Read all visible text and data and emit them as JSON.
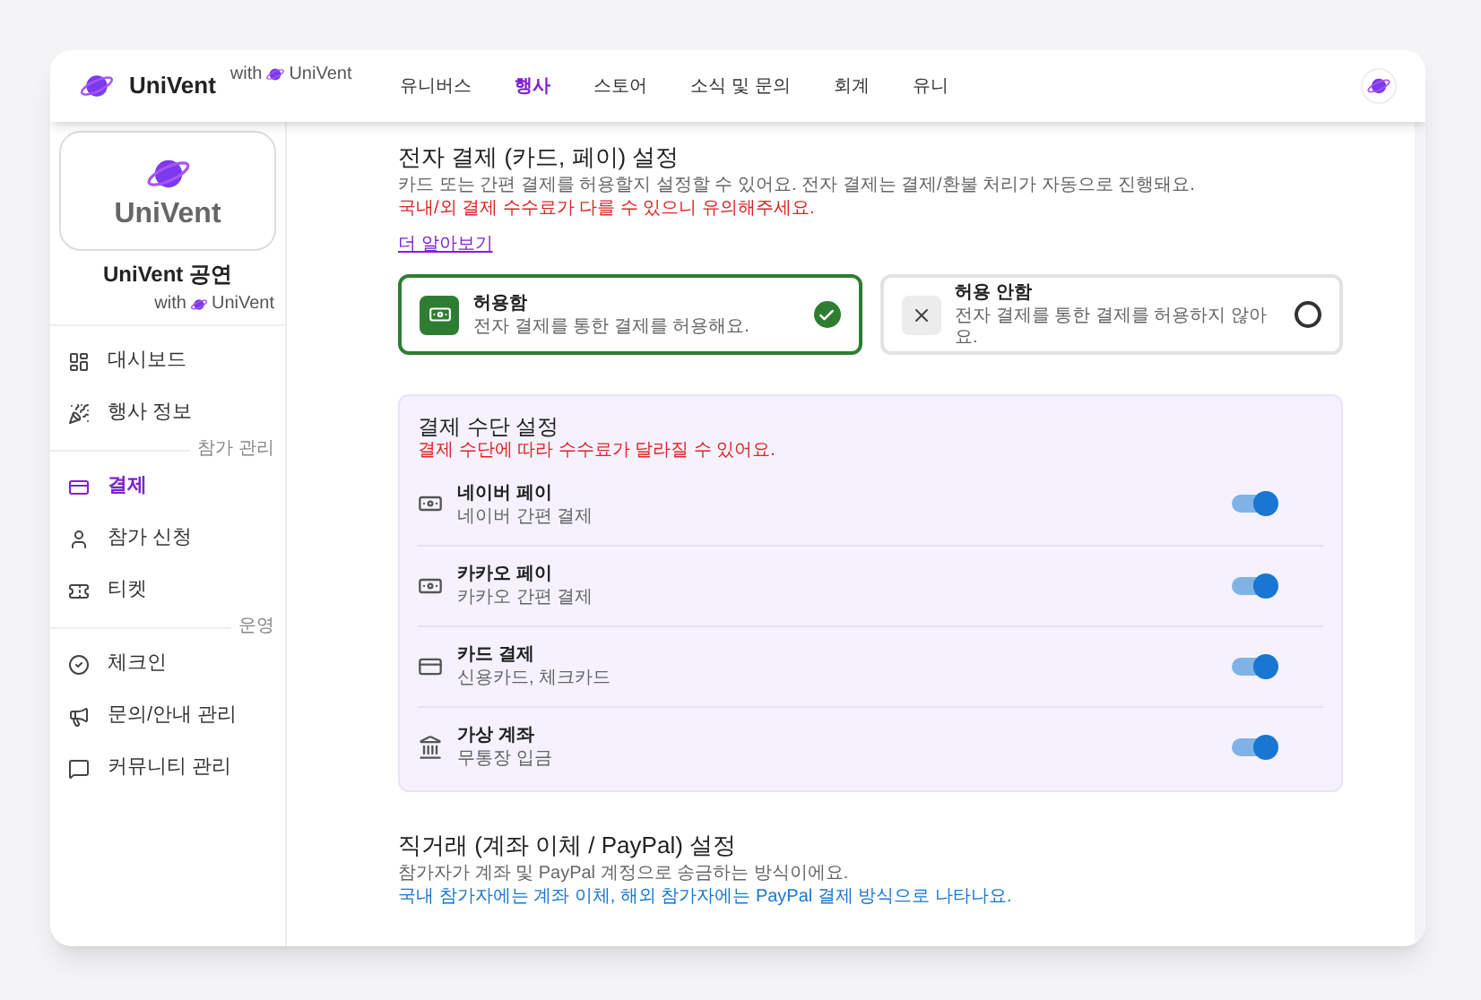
{
  "header": {
    "brand": "UniVent",
    "with_label": "with",
    "with_brand": "UniVent",
    "nav": [
      {
        "label": "유니버스",
        "selected": false
      },
      {
        "label": "행사",
        "selected": true
      },
      {
        "label": "스토어",
        "selected": false
      },
      {
        "label": "소식 및 문의",
        "selected": false
      },
      {
        "label": "회계",
        "selected": false
      },
      {
        "label": "유니",
        "selected": false
      }
    ]
  },
  "sidebar": {
    "logo_text": "UniVent",
    "title": "UniVent 공연",
    "with_label": "with",
    "with_brand": "UniVent",
    "sections": [
      {
        "items": [
          {
            "label": "대시보드",
            "kind": "dashboard",
            "selected": false
          },
          {
            "label": "행사 정보",
            "kind": "party",
            "selected": false
          }
        ]
      },
      {
        "label": "참가 관리",
        "items": [
          {
            "label": "결제",
            "kind": "card",
            "selected": true
          },
          {
            "label": "참가 신청",
            "kind": "person",
            "selected": false
          },
          {
            "label": "티켓",
            "kind": "ticket",
            "selected": false
          }
        ]
      },
      {
        "label": "운영",
        "items": [
          {
            "label": "체크인",
            "kind": "check",
            "selected": false
          },
          {
            "label": "문의/안내 관리",
            "kind": "megaphone",
            "selected": false
          },
          {
            "label": "커뮤니티 관리",
            "kind": "chat",
            "selected": false
          }
        ]
      }
    ]
  },
  "electronic": {
    "title": "전자 결제 (카드, 페이) 설정",
    "description": "카드 또는 간편 결제를 허용할지 설정할 수 있어요. 전자 결제는 결제/환불 처리가 자동으로 진행돼요.",
    "warning": "국내/외 결제 수수료가 다를 수 있으니 유의해주세요.",
    "link": "더 알아보기",
    "options": [
      {
        "kind": "allow",
        "title": "허용함",
        "description": "전자 결제를 통한 결제를 허용해요.",
        "selected": true
      },
      {
        "kind": "deny",
        "title": "허용 안함",
        "description": "전자 결제를 통한 결제를 허용하지 않아요.",
        "selected": false
      }
    ]
  },
  "methods": {
    "title": "결제 수단 설정",
    "warning": "결제 수단에 따라 수수료가 달라질 수 있어요.",
    "items": [
      {
        "kind": "cash",
        "name": "네이버 페이",
        "description": "네이버 간편 결제",
        "on": true
      },
      {
        "kind": "cash",
        "name": "카카오 페이",
        "description": "카카오 간편 결제",
        "on": true
      },
      {
        "kind": "card",
        "name": "카드 결제",
        "description": "신용카드, 체크카드",
        "on": true
      },
      {
        "kind": "bank",
        "name": "가상 계좌",
        "description": "무통장 입금",
        "on": true
      }
    ]
  },
  "direct": {
    "title": "직거래 (계좌 이체 / PayPal) 설정",
    "description": "참가자가 계좌 및 PayPal 계정으로 송금하는 방식이에요.",
    "note": "국내 참가자에는 계좌 이체, 해외 참가자에는 PayPal 결제 방식으로 나타나요."
  }
}
